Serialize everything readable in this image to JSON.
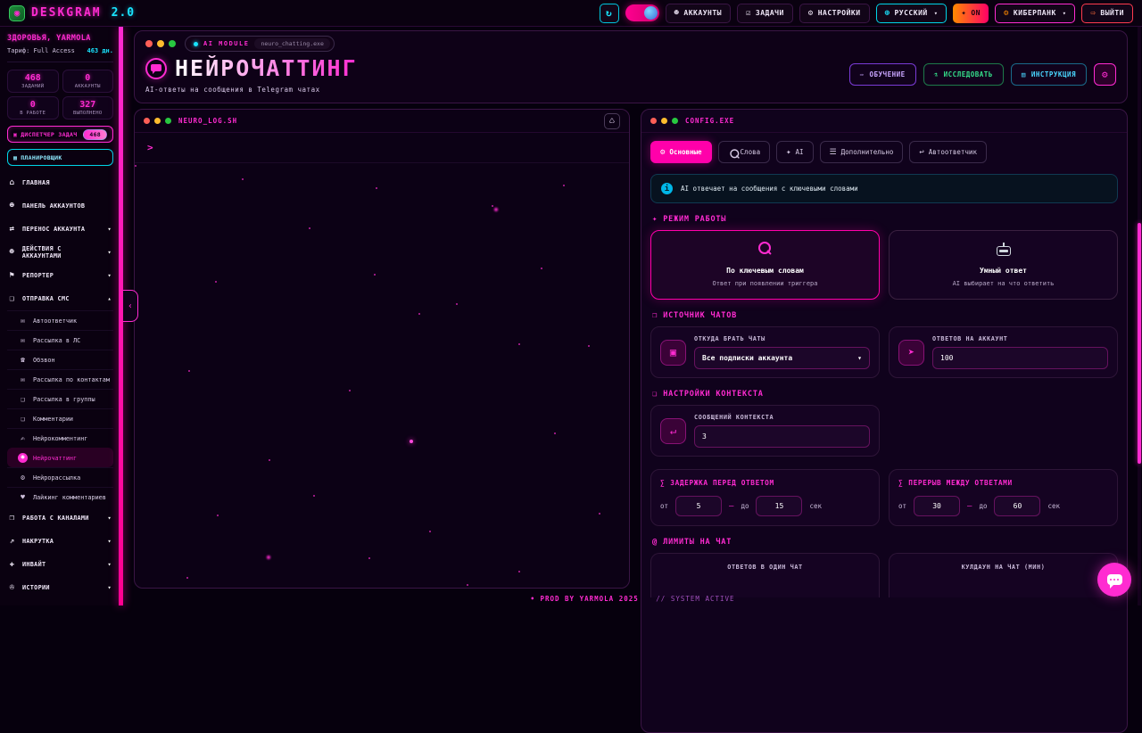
{
  "topbar": {
    "logo_name": "DESKGRAM",
    "logo_version": "2.0",
    "accounts": "АККАУНТЫ",
    "tasks": "ЗАДАЧИ",
    "settings": "НАСТРОЙКИ",
    "language": "РУССКИЙ",
    "power": "ON",
    "theme": "КИБЕРПАНК",
    "logout": "ВЫЙТИ",
    "glyphs": {
      "refresh": "↻",
      "accounts": "☻",
      "tasks": "☑",
      "settings": "⚙",
      "globe": "⊕",
      "spark": "✦",
      "gear": "⚙",
      "exit": "⇨",
      "caret": "▾"
    }
  },
  "sidebar": {
    "greeting": "ЗДОРОВЬЯ, YARMOLA",
    "tariff": "Тариф: Full Access",
    "days": "463 дн.",
    "stats": [
      {
        "value": "468",
        "label": "ЗАДАНИЙ"
      },
      {
        "value": "0",
        "label": "АККАУНТЫ"
      },
      {
        "value": "0",
        "label": "В РАБОТЕ"
      },
      {
        "value": "327",
        "label": "ВЫПОЛНЕНО"
      }
    ],
    "dispatcher": "ДИСПЕТЧЕР ЗАДАЧ",
    "dispatcher_badge": "468",
    "dispatcher_glyph": "▣",
    "scheduler": "ПЛАНИРОВЩИК",
    "scheduler_glyph": "▦",
    "menu": [
      {
        "label": "ГЛАВНАЯ",
        "glyph": "⌂",
        "arrow": ""
      },
      {
        "label": "ПАНЕЛЬ АККАУНТОВ",
        "glyph": "☻",
        "arrow": ""
      },
      {
        "label": "ПЕРЕНОС АККАУНТА",
        "glyph": "⇄",
        "arrow": "▾"
      },
      {
        "label": "ДЕЙСТВИЯ С АККАУНТАМИ",
        "glyph": "☻",
        "arrow": "▾"
      },
      {
        "label": "РЕПОРТЕР",
        "glyph": "⚑",
        "arrow": "▾"
      },
      {
        "label": "ОТПРАВКА СМС",
        "glyph": "❑",
        "arrow": "▴"
      }
    ],
    "submenu": [
      {
        "label": "Автоответчик",
        "glyph": "✉"
      },
      {
        "label": "Рассылка в ЛС",
        "glyph": "✉"
      },
      {
        "label": "Обзвон",
        "glyph": "☎"
      },
      {
        "label": "Рассылка по контактам",
        "glyph": "✉"
      },
      {
        "label": "Рассылка в группы",
        "glyph": "❑"
      },
      {
        "label": "Комментарии",
        "glyph": "❏"
      },
      {
        "label": "Нейрокомментинг",
        "glyph": "✍"
      },
      {
        "label": "Нейрочаттинг",
        "glyph": "☻"
      },
      {
        "label": "Нейрорассылка",
        "glyph": "⚙"
      },
      {
        "label": "Лайкинг комментариев",
        "glyph": "♥"
      }
    ],
    "menu2": [
      {
        "label": "РАБОТА С КАНАЛАМИ",
        "glyph": "❒",
        "arrow": "▾"
      },
      {
        "label": "НАКРУТКА",
        "glyph": "⇗",
        "arrow": "▾"
      },
      {
        "label": "ИНВАЙТ",
        "glyph": "✚",
        "arrow": "▾"
      },
      {
        "label": "ИСТОРИИ",
        "glyph": "✇",
        "arrow": "▾"
      }
    ]
  },
  "header": {
    "badge_label": "AI MODULE",
    "badge_file": "neuro_chatting.exe",
    "title": "НЕЙРОЧАТТИНГ",
    "subtitle": "AI-ответы на сообщения в Telegram чатах",
    "btn_learn": "ОБУЧЕНИЕ",
    "btn_learn_glyph": "✑",
    "btn_explore": "ИССЛЕДОВАТЬ",
    "btn_explore_glyph": "⚗",
    "btn_manual": "ИНСТРУКЦИЯ",
    "btn_manual_glyph": "▤",
    "gear_glyph": "⚙"
  },
  "terminal": {
    "title": "NEURO_LOG.SH",
    "prompt": ">",
    "trash_glyph": "♺"
  },
  "config": {
    "title": "CONFIG.EXE",
    "tabs": [
      {
        "label": "Основные",
        "glyph": "⚙"
      },
      {
        "label": "Слова",
        "glyph": ""
      },
      {
        "label": "AI",
        "glyph": "✦"
      },
      {
        "label": "Дополнительно",
        "glyph": "☰"
      },
      {
        "label": "Автоответчик",
        "glyph": "↩"
      }
    ],
    "info": "AI отвечает на сообщения с ключевыми словами",
    "mode": {
      "title": "РЕЖИМ РАБОТЫ",
      "glyph": "✦",
      "cards": [
        {
          "title": "По ключевым словам",
          "desc": "Ответ при появлении триггера"
        },
        {
          "title": "Умный ответ",
          "desc": "AI выбирает на что ответить"
        }
      ]
    },
    "source": {
      "title": "ИСТОЧНИК ЧАТОВ",
      "glyph": "❐",
      "select_label": "ОТКУДА БРАТЬ ЧАТЫ",
      "select_value": "Все подписки аккаунта",
      "select_glyph": "▣",
      "input_label": "ОТВЕТОВ НА АККАУНТ",
      "input_value": "100",
      "input_glyph": "➤"
    },
    "context": {
      "title": "НАСТРОЙКИ КОНТЕКСТА",
      "glyph": "❏",
      "input_label": "СООБЩЕНИЙ КОНТЕКСТА",
      "input_value": "3",
      "input_glyph": "↵"
    },
    "delay": {
      "title": "ЗАДЕРЖКА ПЕРЕД ОТВЕТОМ",
      "glyph": "∑",
      "from_label": "от",
      "from_value": "5",
      "dash": "—",
      "to_label": "до",
      "to_value": "15",
      "unit": "сек"
    },
    "pause": {
      "title": "ПЕРЕРЫВ МЕЖДУ ОТВЕТАМИ",
      "glyph": "∑",
      "from_label": "от",
      "from_value": "30",
      "dash": "—",
      "to_label": "до",
      "to_value": "60",
      "unit": "сек"
    },
    "limits": {
      "title": "ЛИМИТЫ НА ЧАТ",
      "glyph": "@",
      "left_label": "ОТВЕТОВ В ОДИН ЧАТ",
      "right_label": "КУЛДАУН НА ЧАТ (МИН)"
    }
  },
  "footer": {
    "main": "• PROD BY YARMOLA 2025",
    "system": "// SYSTEM ACTIVE"
  },
  "colors": {
    "accent_pink": "#ff2bd1",
    "accent_cyan": "#19e4ff",
    "accent_orange": "#ff8a00",
    "active_tab": "#ff00aa"
  }
}
